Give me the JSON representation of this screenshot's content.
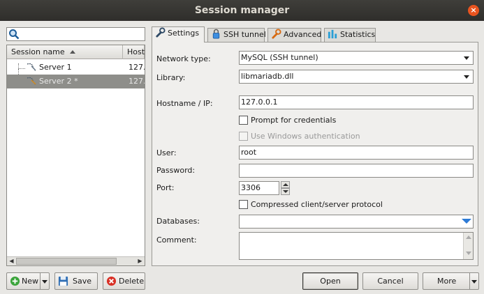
{
  "window": {
    "title": "Session manager",
    "close_glyph": "×"
  },
  "search": {
    "value": "",
    "icon": "search-icon"
  },
  "tree": {
    "columns": [
      "Session name",
      "Host"
    ],
    "rows": [
      {
        "name": "Server 1",
        "host": "127..",
        "selected": false
      },
      {
        "name": "Server 2 *",
        "host": "127..",
        "selected": true
      }
    ]
  },
  "tabs": [
    {
      "label": "Settings",
      "icon": "wrench-icon",
      "active": true
    },
    {
      "label": "SSH tunnel",
      "icon": "lock-icon",
      "active": false
    },
    {
      "label": "Advanced",
      "icon": "wrench-orange-icon",
      "active": false
    },
    {
      "label": "Statistics",
      "icon": "bar-chart-icon",
      "active": false
    }
  ],
  "settings": {
    "network_type_label": "Network type:",
    "network_type_value": "MySQL (SSH tunnel)",
    "library_label": "Library:",
    "library_value": "libmariadb.dll",
    "hostname_label": "Hostname / IP:",
    "hostname_value": "127.0.0.1",
    "prompt_credentials_label": "Prompt for credentials",
    "prompt_credentials_checked": false,
    "windows_auth_label": "Use Windows authentication",
    "windows_auth_checked": false,
    "user_label": "User:",
    "user_value": "root",
    "password_label": "Password:",
    "password_value": "",
    "port_label": "Port:",
    "port_value": "3306",
    "compressed_label": "Compressed client/server protocol",
    "compressed_checked": false,
    "databases_label": "Databases:",
    "databases_value": "",
    "comment_label": "Comment:",
    "comment_value": ""
  },
  "buttons": {
    "new": "New",
    "save": "Save",
    "delete": "Delete",
    "open": "Open",
    "cancel": "Cancel",
    "more": "More"
  },
  "colors": {
    "title_bar": "#2f2e2b",
    "close_button": "#e9541f",
    "selected_row": "#8e8e8a",
    "databases_arrow": "#2d7bd6"
  }
}
